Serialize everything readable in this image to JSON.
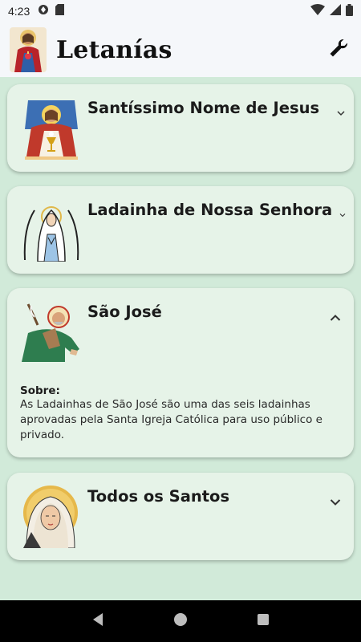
{
  "status_bar": {
    "time": "4:23",
    "icons": [
      "vpn-icon",
      "sd-card-icon",
      "wifi-icon",
      "signal-icon",
      "battery-icon"
    ]
  },
  "app_bar": {
    "title": "Letanías",
    "logo_icon": "sacred-heart-icon",
    "action_icon": "wrench-icon"
  },
  "litanies": [
    {
      "title": "Santíssimo Nome de Jesus",
      "image_icon": "jesus-eucharist-icon",
      "expanded": false
    },
    {
      "title": "Ladainha de Nossa Senhora",
      "image_icon": "our-lady-icon",
      "expanded": false
    },
    {
      "title": "São José",
      "image_icon": "saint-joseph-icon",
      "expanded": true,
      "about_label": "Sobre:",
      "about_text": "As Ladainhas de São José são uma das seis ladainhas aprovadas pela Santa Igreja Católica para uso público e privado."
    },
    {
      "title": "Todos os Santos",
      "image_icon": "saint-nun-icon",
      "expanded": false
    }
  ],
  "colors": {
    "background": "#d1ead9",
    "card": "#e6f3e8",
    "app_bar": "#f5f7fa",
    "nav_bar": "#000000"
  },
  "nav_bar": {
    "icons": [
      "back-icon",
      "home-icon",
      "recents-icon"
    ]
  }
}
